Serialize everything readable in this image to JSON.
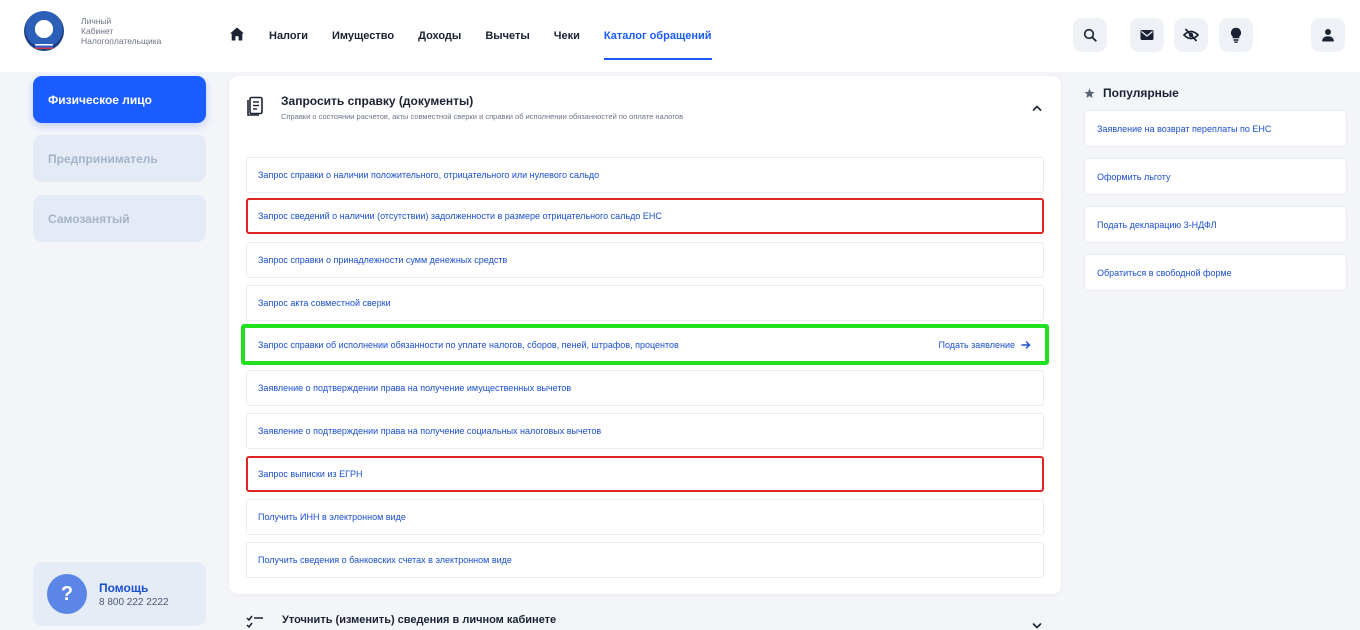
{
  "brand": {
    "line1": "Личный",
    "line2": "Кабинет",
    "line3": "Налогоплательщика"
  },
  "nav": {
    "items": [
      {
        "label": "Налоги"
      },
      {
        "label": "Имущество"
      },
      {
        "label": "Доходы"
      },
      {
        "label": "Вычеты"
      },
      {
        "label": "Чеки"
      },
      {
        "label": "Каталог обращений"
      }
    ],
    "active_index": 5
  },
  "header_icons": [
    "search-icon",
    "mail-icon",
    "eye-off-icon",
    "lightbulb-icon",
    "user-icon"
  ],
  "sidebar": {
    "items": [
      {
        "label": "Физическое лицо"
      },
      {
        "label": "Предприниматель"
      },
      {
        "label": "Самозанятый"
      }
    ],
    "active_index": 0
  },
  "help": {
    "title": "Помощь",
    "phone": "8 800 222 2222",
    "icon": "?"
  },
  "section": {
    "title": "Запросить справку (документы)",
    "subtitle": "Справки о состоянии расчетов, акты совместной сверки и справки об исполнении обязанностей по оплате налогов",
    "rows": [
      {
        "label": "Запрос справки о наличии положительного, отрицательного или нулевого сальдо"
      },
      {
        "label": "Запрос сведений о наличии (отсутствии) задолженности в размере отрицательного сальдо ЕНС"
      },
      {
        "label": "Запрос справки о принадлежности сумм денежных средств"
      },
      {
        "label": "Запрос акта совместной сверки"
      },
      {
        "label": "Запрос справки об исполнении обязанности по уплате налогов, сборов, пеней, штрафов, процентов",
        "action": "Подать заявление"
      },
      {
        "label": "Заявление о подтверждении права на получение имущественных вычетов"
      },
      {
        "label": "Заявление о подтверждении права на получение социальных налоговых вычетов"
      },
      {
        "label": "Запрос выписки из ЕГРН"
      },
      {
        "label": "Получить ИНН в электронном виде"
      },
      {
        "label": "Получить сведения о банковских счетах в электронном виде"
      }
    ]
  },
  "next_section": {
    "title": "Уточнить (изменить) сведения в личном кабинете"
  },
  "popular": {
    "title": "Популярные",
    "items": [
      {
        "label": "Заявление на возврат переплаты по ЕНС"
      },
      {
        "label": "Оформить льготу"
      },
      {
        "label": "Подать декларацию 3-НДФЛ"
      },
      {
        "label": "Обратиться в свободной форме"
      }
    ]
  },
  "colors": {
    "accent": "#1a5cff",
    "highlight_red": "#e02424",
    "highlight_green": "#22e022"
  }
}
